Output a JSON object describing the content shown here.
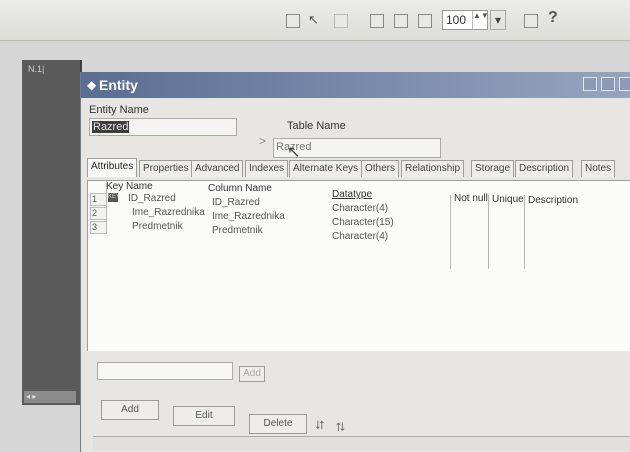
{
  "toolbar": {
    "zoom_value": "100",
    "zoom_spin": "▲▼",
    "dropdown_arrow": "▾",
    "help_label": "?"
  },
  "left_panel": {
    "label": "N.1|",
    "scroll_label": "◂ ▸"
  },
  "window": {
    "title": "Entity",
    "icon": "entity-icon"
  },
  "entity": {
    "entity_name_label": "Entity Name",
    "entity_name_value": "Razred",
    "separator": ">",
    "table_name_label": "Table Name",
    "table_name_value": "Razred"
  },
  "tabs": [
    {
      "label": "Attributes"
    },
    {
      "label": "Properties"
    },
    {
      "label": "Advanced"
    },
    {
      "label": "Indexes"
    },
    {
      "label": "Alternate Keys"
    },
    {
      "label": "Others"
    },
    {
      "label": "Relationship"
    },
    {
      "label": "Storage"
    },
    {
      "label": "Description"
    },
    {
      "label": "Notes"
    }
  ],
  "grid": {
    "headers": {
      "key": "Key",
      "name": "Name",
      "column_name": "Column Name",
      "datatype": "Datatype",
      "not_null": "Not null",
      "unique": "Unique",
      "description": "Description"
    },
    "rows": [
      {
        "num": "1",
        "key": "KEY",
        "name": "ID_Razred",
        "column": "ID_Razred",
        "datatype": "Character(4)"
      },
      {
        "num": "2",
        "key": "",
        "name": "Ime_Razrednika",
        "column": "Ime_Razrednika",
        "datatype": "Character(15)"
      },
      {
        "num": "3",
        "key": "",
        "name": "Predmetnik",
        "column": "Predmetnik",
        "datatype": "Character(4)"
      }
    ]
  },
  "bottom": {
    "add_small_label": "Add",
    "add_label": "Add",
    "edit_label": "Edit",
    "delete_label": "Delete",
    "move_up_icon": "up-arrows-icon",
    "move_down_icon": "down-arrows-icon"
  }
}
